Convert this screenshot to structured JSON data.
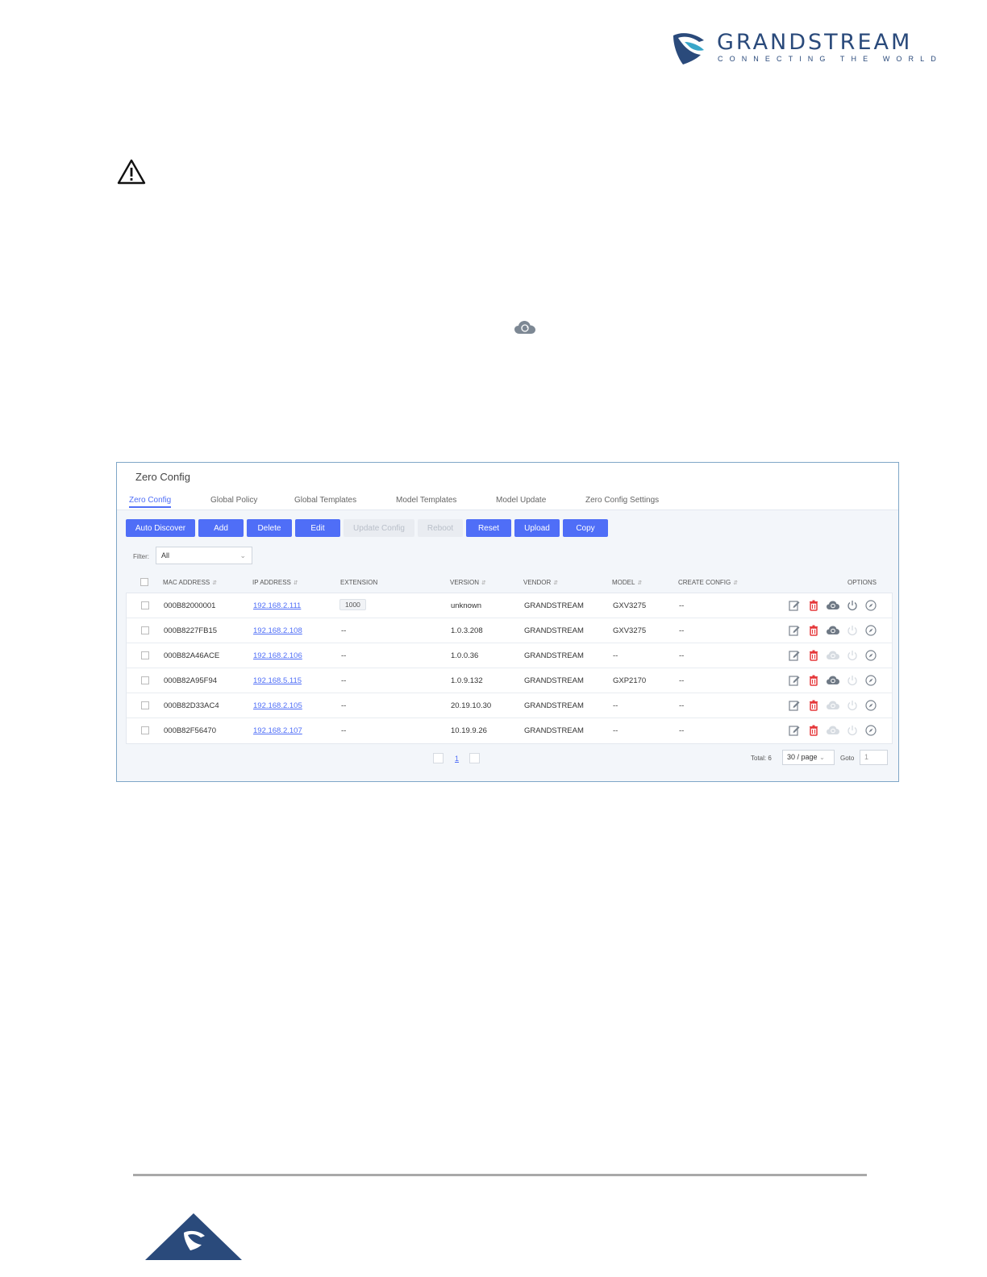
{
  "brand": {
    "name": "GRANDSTREAM",
    "tagline": "CONNECTING THE WORLD",
    "colors": {
      "primary": "#2a4a7b",
      "accent": "#4f6ef7",
      "danger": "#e5383b"
    }
  },
  "icons": {
    "warning": "warning-icon",
    "cloud": "cloud-update-icon"
  },
  "panel": {
    "title": "Zero Config",
    "tabs": [
      "Zero Config",
      "Global Policy",
      "Global Templates",
      "Model Templates",
      "Model Update",
      "Zero Config Settings"
    ],
    "active_tab": "Zero Config",
    "buttons": {
      "auto_discover": "Auto Discover",
      "add": "Add",
      "delete": "Delete",
      "edit": "Edit",
      "update_config": "Update Config",
      "reboot": "Reboot",
      "reset": "Reset",
      "upload": "Upload",
      "copy": "Copy"
    },
    "filter": {
      "label": "Filter:",
      "value": "All"
    },
    "columns": {
      "mac": "MAC ADDRESS",
      "ip": "IP ADDRESS",
      "extension": "EXTENSION",
      "version": "VERSION",
      "vendor": "VENDOR",
      "model": "MODEL",
      "create_config": "CREATE CONFIG",
      "options": "OPTIONS"
    },
    "rows": [
      {
        "mac": "000B82000001",
        "ip": "192.168.2.111",
        "extension": "1000",
        "version": "unknown",
        "vendor": "GRANDSTREAM",
        "model": "GXV3275",
        "create_config": "--",
        "cloud_active": true,
        "power_active": true
      },
      {
        "mac": "000B8227FB15",
        "ip": "192.168.2.108",
        "extension": "--",
        "version": "1.0.3.208",
        "vendor": "GRANDSTREAM",
        "model": "GXV3275",
        "create_config": "--",
        "cloud_active": true,
        "power_active": false
      },
      {
        "mac": "000B82A46ACE",
        "ip": "192.168.2.106",
        "extension": "--",
        "version": "1.0.0.36",
        "vendor": "GRANDSTREAM",
        "model": "--",
        "create_config": "--",
        "cloud_active": false,
        "power_active": false
      },
      {
        "mac": "000B82A95F94",
        "ip": "192.168.5.115",
        "extension": "--",
        "version": "1.0.9.132",
        "vendor": "GRANDSTREAM",
        "model": "GXP2170",
        "create_config": "--",
        "cloud_active": true,
        "power_active": false
      },
      {
        "mac": "000B82D33AC4",
        "ip": "192.168.2.105",
        "extension": "--",
        "version": "20.19.10.30",
        "vendor": "GRANDSTREAM",
        "model": "--",
        "create_config": "--",
        "cloud_active": false,
        "power_active": false
      },
      {
        "mac": "000B82F56470",
        "ip": "192.168.2.107",
        "extension": "--",
        "version": "10.19.9.26",
        "vendor": "GRANDSTREAM",
        "model": "--",
        "create_config": "--",
        "cloud_active": false,
        "power_active": false
      }
    ],
    "pagination": {
      "page": "1",
      "total": "Total: 6",
      "per_page": "30 / page",
      "goto_label": "Goto",
      "goto_value": "1"
    }
  }
}
